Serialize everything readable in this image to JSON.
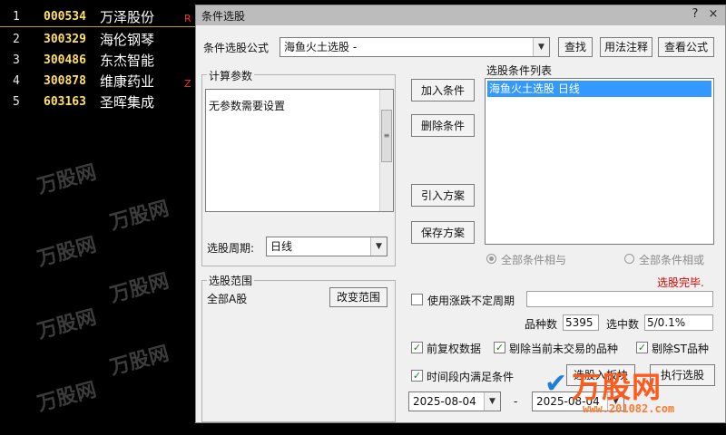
{
  "stocks": [
    {
      "num": "1",
      "code": "000534",
      "name": "万泽股份"
    },
    {
      "num": "2",
      "code": "300329",
      "name": "海伦钢琴"
    },
    {
      "num": "3",
      "code": "300486",
      "name": "东杰智能"
    },
    {
      "num": "4",
      "code": "300878",
      "name": "维康药业"
    },
    {
      "num": "5",
      "code": "603163",
      "name": "圣晖集成"
    }
  ],
  "side_marks": [
    "R",
    "Z"
  ],
  "watermark": "万股网",
  "dialog": {
    "title": "条件选股",
    "window_buttons": {
      "help": "?",
      "close": "×"
    },
    "formula_label": "条件选股公式",
    "formula_value": "海鱼火土选股 -",
    "find_button": "查找",
    "usage_button": "用法注释",
    "view_formula_button": "查看公式",
    "params_title": "计算参数",
    "params_text": "无参数需要设置",
    "cycle_label": "选股周期:",
    "cycle_value": "日线",
    "add_condition": "加入条件",
    "delete_condition": "删除条件",
    "import_plan": "引入方案",
    "save_plan": "保存方案",
    "condition_list_label": "选股条件列表",
    "condition_items": [
      "海鱼火土选股  日线"
    ],
    "radio_and": "全部条件相与",
    "radio_or": "全部条件相或",
    "status_text": "选股完毕.",
    "range_title": "选股范围",
    "range_value": "全部A股",
    "change_range": "改变范围",
    "use_uncertain_cycle": "使用涨跌不定周期",
    "count_label": "品种数",
    "count_value": "5395",
    "selected_label": "选中数",
    "selected_value": "5/0.1%",
    "prior_rights": "前复权数据",
    "exclude_untraded": "剔除当前未交易的品种",
    "exclude_st": "剔除ST品种",
    "time_period": "时间段内满足条件",
    "to_block_button": "选股入板块",
    "execute_button": "执行选股",
    "date_start": "2025-08-04",
    "date_separator": "-",
    "date_end": "2025-08-04"
  },
  "logo": {
    "text": "万股网",
    "url": "www.201082.com"
  },
  "colors": {
    "accent_red": "#e00000",
    "selection_blue": "#3399ff",
    "check_green": "#1a7f1a",
    "logo_orange": "#ff5a1a"
  }
}
